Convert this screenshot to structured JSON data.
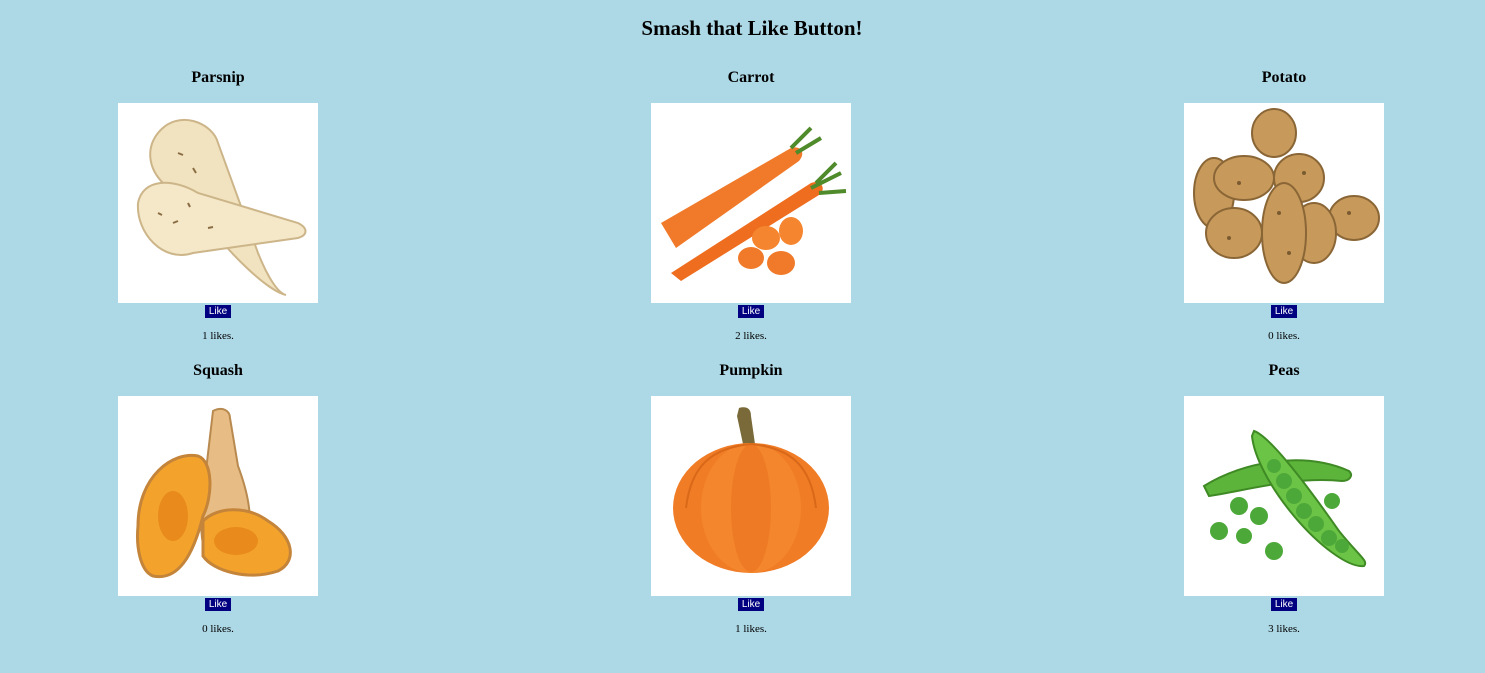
{
  "page": {
    "title": "Smash that Like Button!"
  },
  "items": [
    {
      "name": "Parsnip",
      "button_label": "Like",
      "likes": 1,
      "likes_suffix": " likes.",
      "icon": "parsnip-image"
    },
    {
      "name": "Carrot",
      "button_label": "Like",
      "likes": 2,
      "likes_suffix": " likes.",
      "icon": "carrot-image"
    },
    {
      "name": "Potato",
      "button_label": "Like",
      "likes": 0,
      "likes_suffix": " likes.",
      "icon": "potato-image"
    },
    {
      "name": "Squash",
      "button_label": "Like",
      "likes": 0,
      "likes_suffix": " likes.",
      "icon": "squash-image"
    },
    {
      "name": "Pumpkin",
      "button_label": "Like",
      "likes": 1,
      "likes_suffix": " likes.",
      "icon": "pumpkin-image"
    },
    {
      "name": "Peas",
      "button_label": "Like",
      "likes": 3,
      "likes_suffix": " likes.",
      "icon": "peas-image"
    }
  ],
  "colors": {
    "background": "#add8e6",
    "button": "#000080",
    "button_text": "#ffffff"
  }
}
